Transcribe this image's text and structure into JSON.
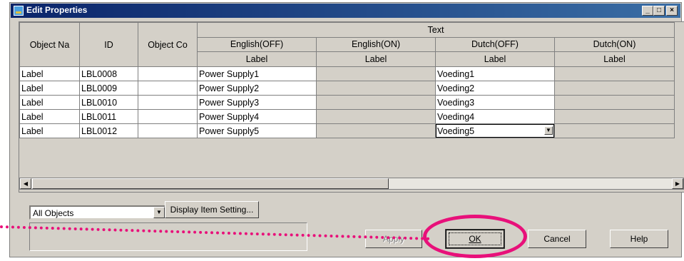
{
  "window": {
    "title": "Edit Properties",
    "controls": [
      "_",
      "□",
      "×"
    ]
  },
  "grid": {
    "headers": {
      "object_name": "Object Na",
      "id": "ID",
      "object_comment": "Object Co",
      "text_group": "Text",
      "languages": [
        "English(OFF)",
        "English(ON)",
        "Dutch(OFF)",
        "Dutch(ON)"
      ],
      "sub_label": "Label"
    },
    "rows": [
      {
        "name": "Label",
        "id": "LBL0008",
        "comment": "",
        "english_off": "Power Supply1",
        "english_on": "",
        "dutch_off": "Voeding1",
        "dutch_on": ""
      },
      {
        "name": "Label",
        "id": "LBL0009",
        "comment": "",
        "english_off": "Power Supply2",
        "english_on": "",
        "dutch_off": "Voeding2",
        "dutch_on": ""
      },
      {
        "name": "Label",
        "id": "LBL0010",
        "comment": "",
        "english_off": "Power Supply3",
        "english_on": "",
        "dutch_off": "Voeding3",
        "dutch_on": ""
      },
      {
        "name": "Label",
        "id": "LBL0011",
        "comment": "",
        "english_off": "Power Supply4",
        "english_on": "",
        "dutch_off": "Voeding4",
        "dutch_on": ""
      },
      {
        "name": "Label",
        "id": "LBL0012",
        "comment": "",
        "english_off": "Power Supply5",
        "english_on": "",
        "dutch_off": "Voeding5",
        "dutch_on": ""
      }
    ]
  },
  "filter": {
    "selected": "All Objects"
  },
  "buttons": {
    "display_item_setting": "Display Item Setting...",
    "apply": "Apply",
    "ok": "OK",
    "cancel": "Cancel",
    "help": "Help"
  },
  "colors": {
    "callout": "#e8107a",
    "titlebar": "#0a246a",
    "face": "#d4d0c8"
  }
}
